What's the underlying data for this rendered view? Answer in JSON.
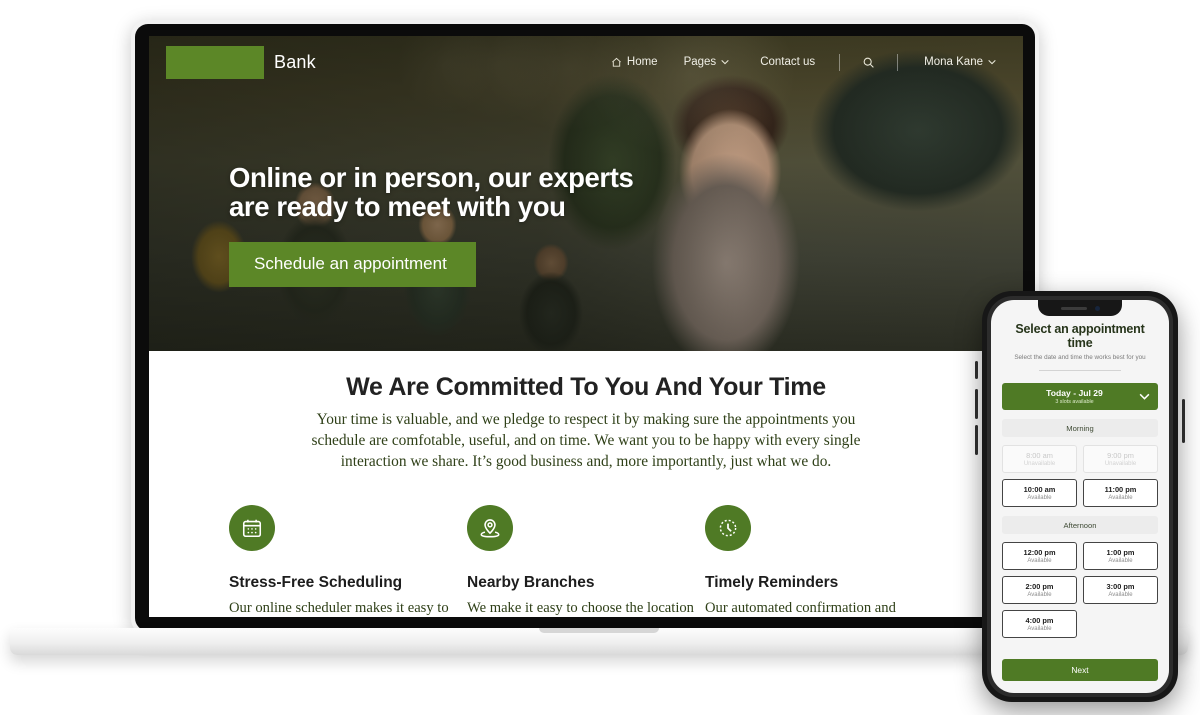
{
  "site": {
    "brand": "Bank",
    "logo_color": "#5c8727",
    "accent_color": "#5c8727"
  },
  "nav": {
    "items": [
      {
        "label": "Home",
        "icon": "home-icon",
        "has_chevron": false
      },
      {
        "label": "Pages",
        "icon": "",
        "has_chevron": true
      },
      {
        "label": "Contact us",
        "icon": "",
        "has_chevron": false
      }
    ],
    "search_icon": "search-icon",
    "account": {
      "label": "Mona Kane",
      "has_chevron": true
    }
  },
  "hero": {
    "title": "Online or in person, our experts\nare ready to meet with you",
    "cta_label": "Schedule an appointment"
  },
  "commitment": {
    "title": "We Are Committed To You And Your Time",
    "body": "Your time is valuable, and we pledge to respect it by making sure the appointments you schedule are comfotable, useful, and on time. We want you to be happy with every single interaction we share. It’s good business and, more importantly, just what we do."
  },
  "features": [
    {
      "icon": "calendar-icon",
      "title": "Stress-Free Scheduling",
      "text": "Our online scheduler makes it easy to get the meeting time"
    },
    {
      "icon": "location-pin-icon",
      "title": "Nearby Branches",
      "text": "We make it easy to choose the location to meet that is"
    },
    {
      "icon": "clock-icon",
      "title": "Timely Reminders",
      "text": "Our automated confirmation and reminder messages helps"
    }
  ],
  "phone": {
    "title": "Select an appointment time",
    "subtitle": "Select the date and time the works best for you",
    "date_picker": {
      "label": "Today - Jul 29",
      "slots_text": "3 slots available",
      "chevron_icon": "chevron-down-icon"
    },
    "sections": [
      {
        "name": "Morning",
        "slots": [
          {
            "time": "8:00 am",
            "status": "Unavailable",
            "available": false
          },
          {
            "time": "9:00 pm",
            "status": "Unavailable",
            "available": false
          },
          {
            "time": "10:00 am",
            "status": "Available",
            "available": true
          },
          {
            "time": "11:00 pm",
            "status": "Available",
            "available": true
          }
        ]
      },
      {
        "name": "Afternoon",
        "slots": [
          {
            "time": "12:00 pm",
            "status": "Available",
            "available": true
          },
          {
            "time": "1:00 pm",
            "status": "Available",
            "available": true
          },
          {
            "time": "2:00 pm",
            "status": "Available",
            "available": true
          },
          {
            "time": "3:00 pm",
            "status": "Available",
            "available": true
          },
          {
            "time": "4:00 pm",
            "status": "Available",
            "available": true
          }
        ]
      }
    ],
    "next_label": "Next"
  }
}
